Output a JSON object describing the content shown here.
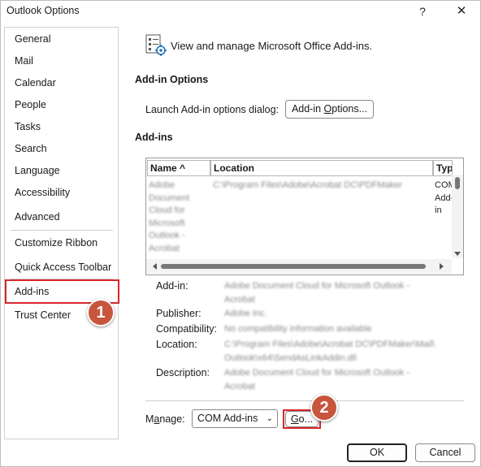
{
  "window": {
    "title": "Outlook Options",
    "help_icon": "?",
    "close_icon": "✕"
  },
  "nav": {
    "items": [
      {
        "label": "General"
      },
      {
        "label": "Mail"
      },
      {
        "label": "Calendar"
      },
      {
        "label": "People"
      },
      {
        "label": "Tasks"
      },
      {
        "label": "Search"
      },
      {
        "label": "Language"
      },
      {
        "label": "Accessibility"
      },
      {
        "label": "Advanced"
      },
      {
        "label": "Customize Ribbon"
      },
      {
        "label": "Quick Access Toolbar"
      },
      {
        "label": "Add-ins",
        "selected": true
      },
      {
        "label": "Trust Center"
      }
    ]
  },
  "annotations": {
    "badge1": "1",
    "badge2": "2",
    "highlight_color": "#d7262b",
    "badge_color": "#c8553d"
  },
  "main": {
    "header_icon": "addins-gear-icon",
    "header_text": "View and manage Microsoft Office Add-ins.",
    "addin_options_title": "Add-in Options",
    "launch_label": "Launch Add-in options dialog:",
    "addin_options_button_pre": "Add-in ",
    "addin_options_button_u": "O",
    "addin_options_button_post": "ptions...",
    "addins_title": "Add-ins",
    "table": {
      "columns": [
        "Name",
        "Location",
        "Typ"
      ],
      "sort_indicator": "^",
      "row": {
        "name": "Adobe\nDocument\nCloud for\nMicrosoft\nOutlook -\nAcrobat",
        "location": "C:\\Program Files\\Adobe\\Acrobat DC\\PDFMaker",
        "type": "COM\nAdd-\nin"
      }
    },
    "details": {
      "addin_label": "Add-in:",
      "addin_value": "Adobe Document Cloud for Microsoft Outlook -\nAcrobat",
      "publisher_label": "Publisher:",
      "publisher_value": "Adobe Inc.",
      "compat_label": "Compatibility:",
      "compat_value": "No compatibility information available",
      "location_label": "Location:",
      "location_value": "C:\\Program Files\\Adobe\\Acrobat DC\\PDFMaker\\Mail\\\nOutlook\\x64\\SendAsLinkAddin.dll",
      "description_label": "Description:",
      "description_value": "Adobe Document Cloud for Microsoft Outlook -\nAcrobat"
    },
    "manage_label_pre": "M",
    "manage_label_u": "a",
    "manage_label_post": "nage:",
    "manage_selected": "COM Add-ins",
    "go_button_u": "G",
    "go_button_post": "o..."
  },
  "footer": {
    "ok_label": "OK",
    "cancel_label": "Cancel"
  }
}
